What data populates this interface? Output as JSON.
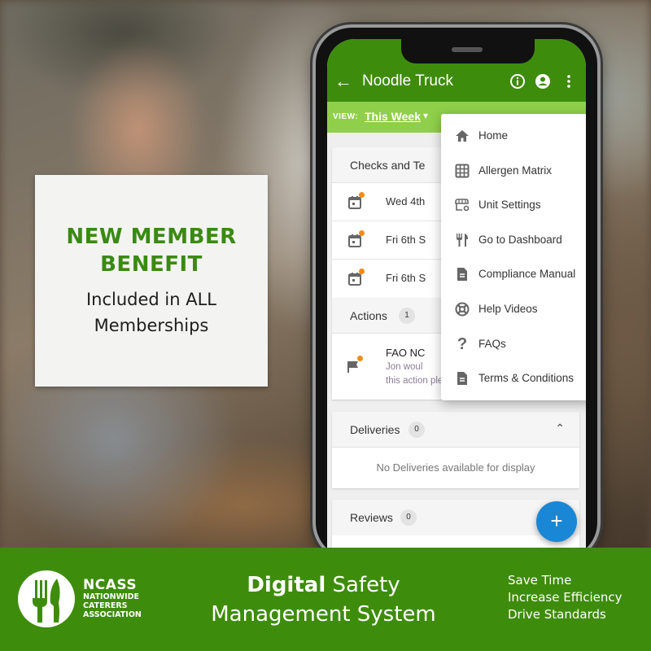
{
  "promo": {
    "title_line1": "NEW MEMBER",
    "title_line2": "BENEFIT",
    "subtitle_line1": "Included in ALL",
    "subtitle_line2": "Memberships"
  },
  "app": {
    "title": "Noodle Truck",
    "back_icon": "arrow-left-icon",
    "header_icons": [
      "info-icon",
      "account-icon",
      "more-vert-icon"
    ],
    "view_label": "VIEW:",
    "view_value": "This Week",
    "sections": {
      "checks": {
        "title": "Checks and Te",
        "rows": [
          {
            "text": "Wed 4th",
            "icon": "calendar-icon"
          },
          {
            "text": "Fri 6th S",
            "icon": "calendar-icon"
          },
          {
            "text": "Fri 6th S",
            "icon": "calendar-icon"
          }
        ]
      },
      "actions": {
        "title": "Actions",
        "count": "1",
        "item_title": "FAO NC",
        "item_text_line1": "Jon woul",
        "item_text_line2": "this action please"
      },
      "deliveries": {
        "title": "Deliveries",
        "count": "0",
        "empty": "No Deliveries available for display"
      },
      "reviews": {
        "title": "Reviews",
        "count": "0"
      }
    },
    "fab_label": "+",
    "menu": [
      {
        "label": "Home",
        "icon": "home-icon"
      },
      {
        "label": "Allergen Matrix",
        "icon": "grid-icon"
      },
      {
        "label": "Unit Settings",
        "icon": "store-settings-icon"
      },
      {
        "label": "Go to Dashboard",
        "icon": "utensils-icon"
      },
      {
        "label": "Compliance Manual",
        "icon": "document-icon"
      },
      {
        "label": "Help Videos",
        "icon": "lifebuoy-icon"
      },
      {
        "label": "FAQs",
        "icon": "question-icon"
      },
      {
        "label": "Terms & Conditions",
        "icon": "document-icon"
      }
    ]
  },
  "footer": {
    "org_short": "NCASS",
    "org_line1": "NATIONWIDE",
    "org_line2": "CATERERS",
    "org_line3": "ASSOCIATION",
    "headline_bold": "Digital",
    "headline_rest": " Safety",
    "headline_line2": "Management System",
    "taglines": [
      "Save Time",
      "Increase Efficiency",
      "Drive Standards"
    ]
  },
  "colors": {
    "brand_green": "#3e8c0b",
    "view_bar_green": "#8fcf4a",
    "fab_blue": "#1a86d6",
    "notification_orange": "#f28c16"
  }
}
